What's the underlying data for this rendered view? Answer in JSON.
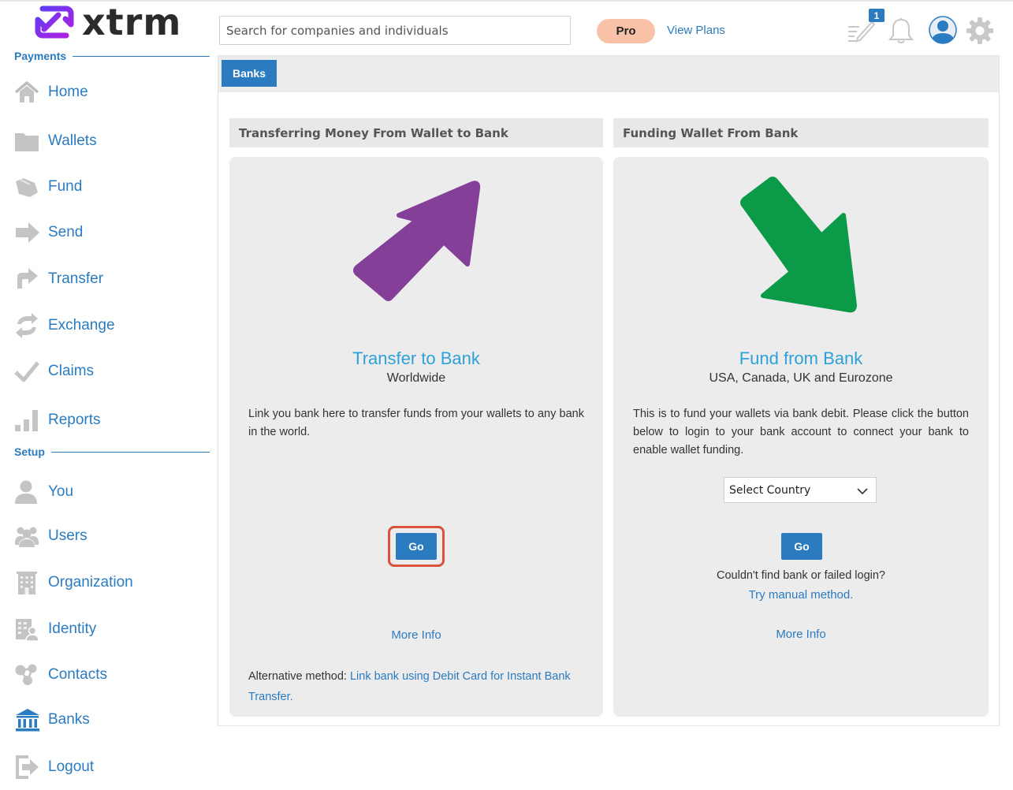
{
  "app": {
    "logo_text": "xtrm"
  },
  "header": {
    "search_placeholder": "Search for companies and individuals",
    "pro_label": "Pro",
    "view_plans_label": "View Plans",
    "notification_count": "1"
  },
  "sidebar": {
    "payments_heading": "Payments",
    "setup_heading": "Setup",
    "payments_items": [
      {
        "label": "Home",
        "icon": "home-icon"
      },
      {
        "label": "Wallets",
        "icon": "folder-icon"
      },
      {
        "label": "Fund",
        "icon": "fund-icon"
      },
      {
        "label": "Send",
        "icon": "send-arrow-icon"
      },
      {
        "label": "Transfer",
        "icon": "transfer-icon"
      },
      {
        "label": "Exchange",
        "icon": "exchange-icon"
      },
      {
        "label": "Claims",
        "icon": "checkmark-icon"
      },
      {
        "label": "Reports",
        "icon": "bar-chart-icon"
      }
    ],
    "setup_items": [
      {
        "label": "You",
        "icon": "person-icon"
      },
      {
        "label": "Users",
        "icon": "users-icon"
      },
      {
        "label": "Organization",
        "icon": "building-icon"
      },
      {
        "label": "Identity",
        "icon": "identity-icon"
      },
      {
        "label": "Contacts",
        "icon": "contacts-icon"
      },
      {
        "label": "Banks",
        "icon": "bank-icon"
      },
      {
        "label": "Logout",
        "icon": "logout-icon"
      }
    ]
  },
  "main": {
    "tab_label": "Banks",
    "left": {
      "header": "Transferring Money From Wallet to Bank",
      "title": "Transfer to Bank",
      "subtitle": "Worldwide",
      "description": "Link you bank here to transfer funds from your wallets to any bank in the world.",
      "go_label": "Go",
      "more_info": "More Info",
      "alt_prefix": "Alternative method: ",
      "alt_link": "Link bank using Debit Card for Instant Bank Transfer.",
      "arrow_color": "#843f98"
    },
    "right": {
      "header": "Funding Wallet From Bank",
      "title": "Fund from Bank",
      "subtitle": "USA, Canada, UK and Eurozone",
      "description": "This is to fund your wallets via bank debit. Please click the button below to login to your bank account to connect your bank to enable wallet funding.",
      "select_value": "Select Country",
      "go_label": "Go",
      "help_text": "Couldn't find bank or failed login?",
      "manual_link": "Try manual method.",
      "more_info": "More Info",
      "arrow_color": "#0a9a48"
    }
  },
  "colors": {
    "accent": "#2b7bc0",
    "title_blue": "#2ea1d8",
    "highlight": "#d9533f",
    "pro_badge": "#f9c2a8",
    "logo_purple": "#7b2ff2"
  }
}
